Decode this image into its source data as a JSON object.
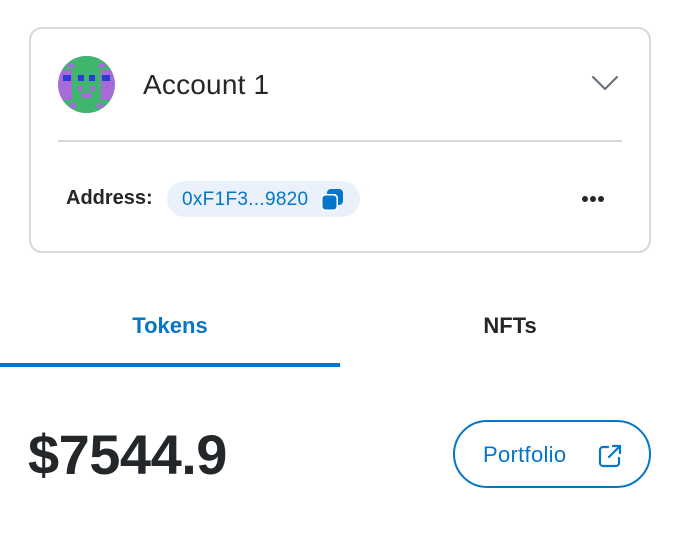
{
  "account": {
    "name": "Account 1",
    "avatar_icon": "jazzicon-avatar",
    "dropdown_icon": "chevron-down-icon"
  },
  "address": {
    "label": "Address:",
    "value": "0xF1F3...9820",
    "copy_icon": "copy-icon",
    "menu_icon": "more-horizontal-icon"
  },
  "tabs": [
    {
      "label": "Tokens",
      "active": true
    },
    {
      "label": "NFTs",
      "active": false
    }
  ],
  "balance": {
    "amount": "$7544.9"
  },
  "portfolio": {
    "label": "Portfolio",
    "icon": "external-link-icon"
  },
  "colors": {
    "accent": "#0376c9",
    "text": "#24272a",
    "border": "#d6d9dc",
    "pill_bg": "#eaf1fa"
  }
}
